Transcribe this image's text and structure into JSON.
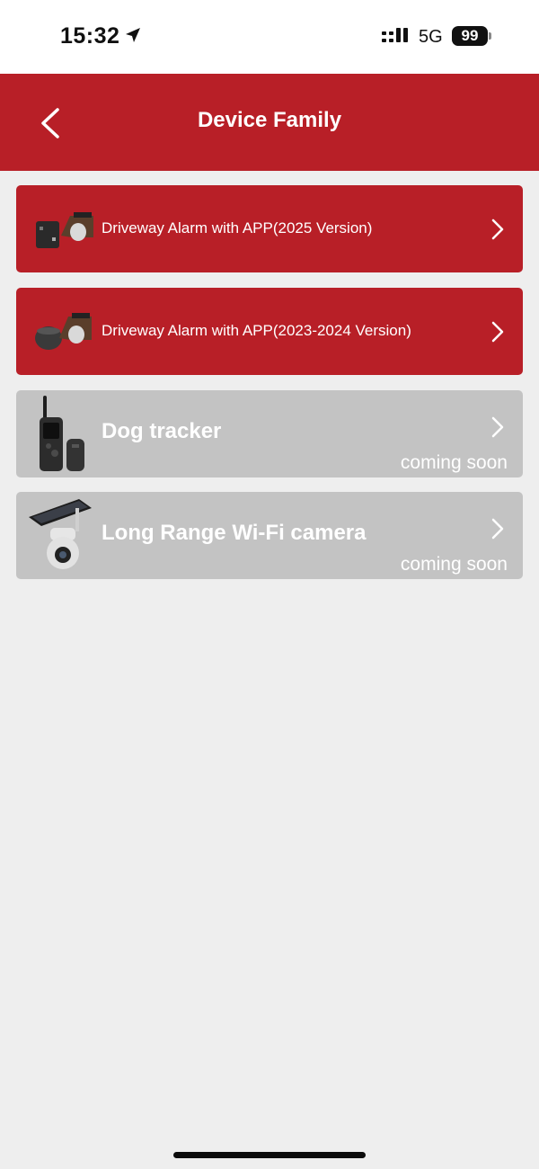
{
  "status_bar": {
    "time": "15:32",
    "network": "5G",
    "battery": "99"
  },
  "header": {
    "title": "Device Family",
    "back_icon": "chevron-left-icon"
  },
  "devices": [
    {
      "label": "Driveway Alarm with APP(2025 Version)",
      "status": "",
      "icon": "chevron-right-icon"
    },
    {
      "label": "Driveway Alarm with APP(2023-2024 Version)",
      "status": "",
      "icon": "chevron-right-icon"
    },
    {
      "label": "Dog tracker",
      "status": "coming soon",
      "icon": "chevron-right-icon"
    },
    {
      "label": "Long Range Wi-Fi camera",
      "status": "coming soon",
      "icon": "chevron-right-icon"
    }
  ],
  "colors": {
    "brand_red": "#b81f27",
    "disabled_gray": "#c3c3c3",
    "background": "#eeeeee"
  }
}
